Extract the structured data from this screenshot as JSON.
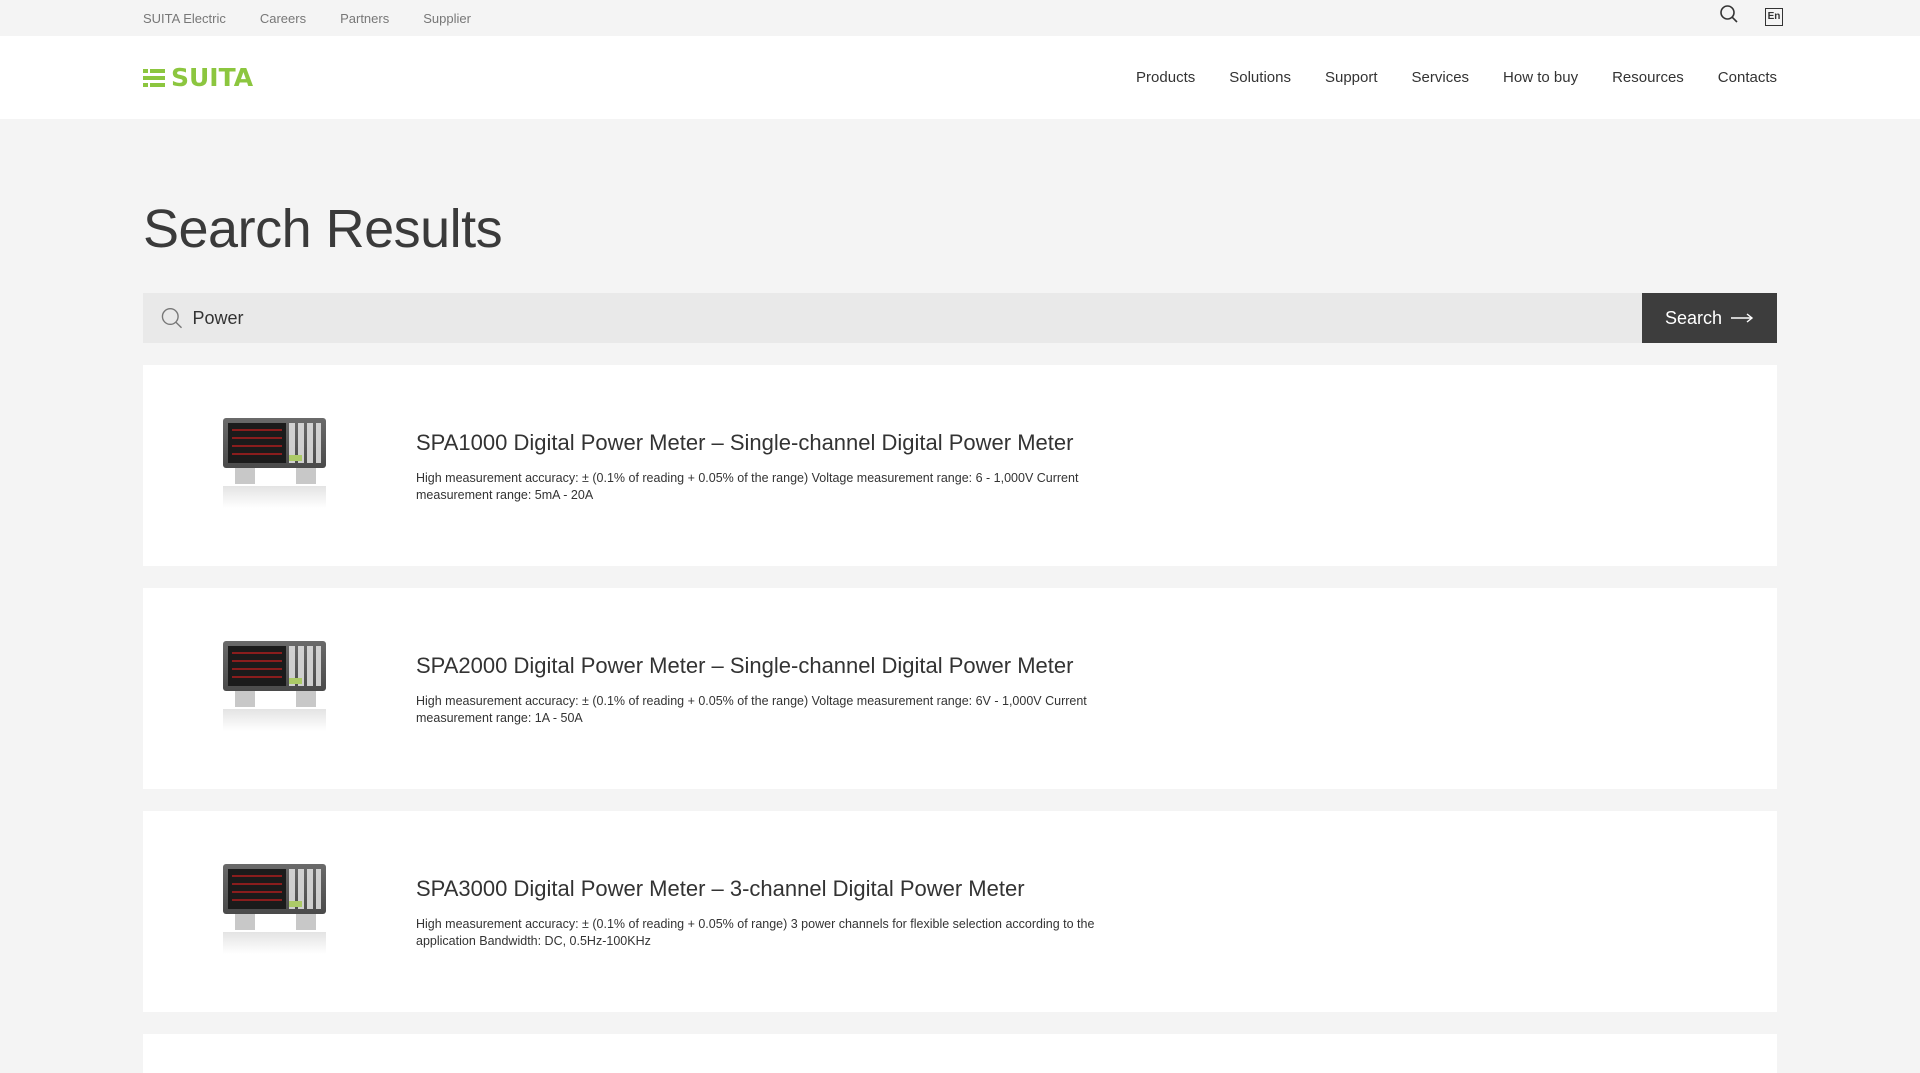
{
  "topbar": {
    "links": [
      "SUITA Electric",
      "Careers",
      "Partners",
      "Supplier"
    ],
    "search_icon": "search-icon",
    "lang_label": "En"
  },
  "header": {
    "logo_text": "SUITA",
    "nav": [
      "Products",
      "Solutions",
      "Support",
      "Services",
      "How to buy",
      "Resources",
      "Contacts"
    ]
  },
  "page": {
    "title": "Search Results"
  },
  "search": {
    "value": "Power",
    "button_label": "Search"
  },
  "results": [
    {
      "title": "SPA1000 Digital Power Meter – Single-channel Digital Power Meter",
      "description": "High measurement accuracy: ± (0.1% of reading + 0.05% of the range) Voltage measurement range: 6 - 1,000V Current measurement range: 5mA - 20A"
    },
    {
      "title": "SPA2000 Digital Power Meter – Single-channel Digital Power Meter",
      "description": "High measurement accuracy: ± (0.1% of reading + 0.05% of the range) Voltage measurement range: 6V - 1,000V Current measurement range: 1A - 50A"
    },
    {
      "title": "SPA3000 Digital Power Meter – 3-channel Digital Power Meter",
      "description": "High measurement accuracy: ± (0.1% of reading + 0.05% of range) 3 power channels for flexible selection according to the application Bandwidth: DC, 0.5Hz-100KHz"
    }
  ],
  "colors": {
    "brand": "#8cc63f",
    "button_bg": "#3d3d3d",
    "page_bg": "#f4f4f4"
  }
}
